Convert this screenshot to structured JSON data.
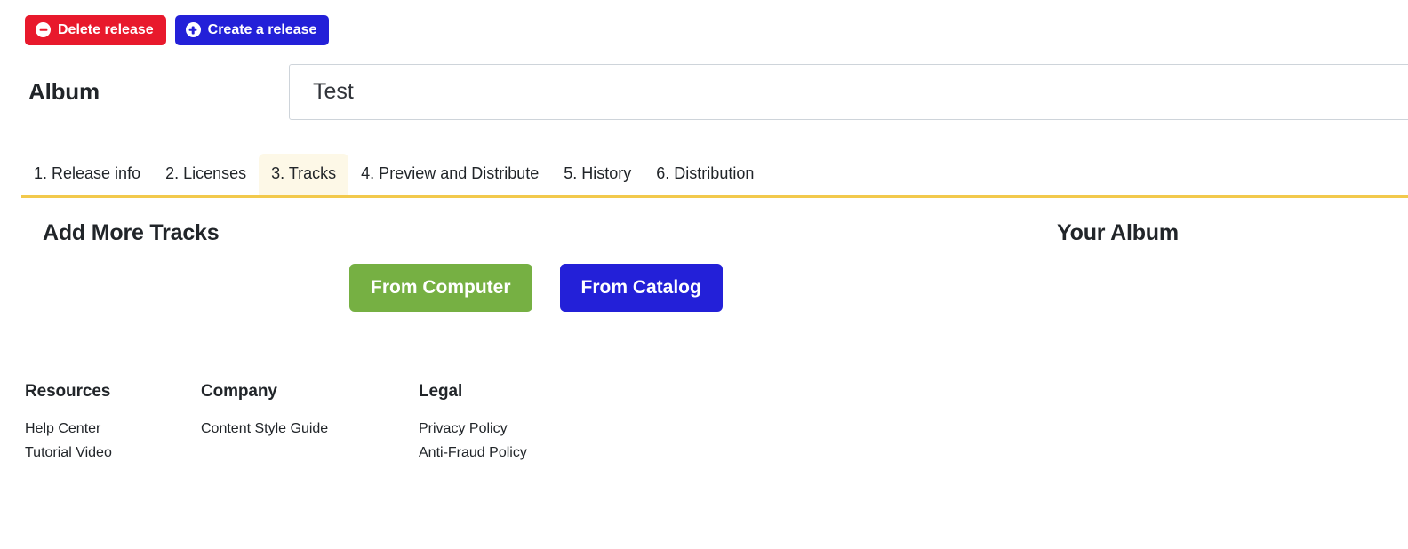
{
  "action_bar": {
    "delete_button": {
      "label": "Delete release",
      "icon": "minus-circle-icon",
      "color": "#e8192c"
    },
    "create_button": {
      "label": "Create a release",
      "icon": "plus-circle-icon",
      "color": "#2320d8"
    }
  },
  "release": {
    "type_label": "Album",
    "title_value": "Test",
    "title_placeholder": "Release title"
  },
  "tabs": {
    "active_index": 2,
    "accent_color": "#f2c94c",
    "active_background": "#fdf8e7",
    "items": [
      {
        "label": "1. Release info"
      },
      {
        "label": "2. Licenses"
      },
      {
        "label": "3. Tracks"
      },
      {
        "label": "4. Preview and Distribute"
      },
      {
        "label": "5. History"
      },
      {
        "label": "6. Distribution"
      }
    ]
  },
  "main": {
    "add_tracks_heading": "Add More Tracks",
    "your_album_heading": "Your Album",
    "from_computer_button": {
      "label": "From Computer",
      "color": "#76b043"
    },
    "from_catalog_button": {
      "label": "From Catalog",
      "color": "#2320d8"
    }
  },
  "footer": {
    "columns": [
      {
        "title": "Resources",
        "links": [
          {
            "label": "Help Center"
          },
          {
            "label": "Tutorial Video"
          }
        ]
      },
      {
        "title": "Company",
        "links": [
          {
            "label": "Content Style Guide"
          }
        ]
      },
      {
        "title": "Legal",
        "links": [
          {
            "label": "Privacy Policy"
          },
          {
            "label": "Anti-Fraud Policy"
          }
        ]
      }
    ]
  }
}
